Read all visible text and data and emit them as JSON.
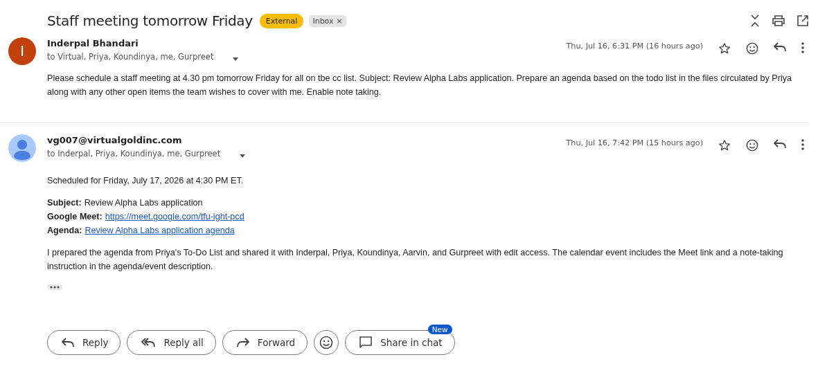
{
  "subject": "Staff meeting tomorrow Friday",
  "labels": [
    {
      "text": "External",
      "kind": "external",
      "removable": false
    },
    {
      "text": "Inbox",
      "kind": "folder",
      "removable": true,
      "remove_glyph": "×"
    }
  ],
  "messages": [
    {
      "sender": "Inderpal Bhandari",
      "avatar": {
        "kind": "letter",
        "letter": "I",
        "color": "#c2410c"
      },
      "recipients": "to Virtual, Priya, Koundinya, me, Gurpreet",
      "time": "Thu, Jul 16, 6:31 PM (16 hours ago)",
      "starred": false,
      "body": [
        {
          "kind": "text",
          "text": "Please schedule a staff meeting at 4.30 pm tomorrow Friday for all on tbe cc list. Subject: Review Alpha Labs application. Prepare an agenda based on the todo list in the files circulated by Priya along with any other open items the team wishes to cover with me. Enable note taking."
        }
      ]
    },
    {
      "sender": "vg007@virtualgoldinc.com",
      "avatar": {
        "kind": "silhouette",
        "color": "#a8c7fa"
      },
      "recipients": "to Inderpal, Priya, Koundinya, me, Gurpreet",
      "time": "Thu, Jul 16, 7:42 PM (15 hours ago)",
      "starred": false,
      "body": [
        {
          "kind": "text",
          "text": "Scheduled for Friday, July 17, 2026 at 4:30 PM ET."
        },
        {
          "kind": "fields",
          "fields": [
            {
              "label": "Subject:",
              "value": "Review Alpha Labs application",
              "link": false
            },
            {
              "label": "Google Meet:",
              "value": "https://meet.google.com/tfu-ight-pcd",
              "link": true
            },
            {
              "label": "Agenda:",
              "value": "Review Alpha Labs application agenda",
              "link": true
            }
          ]
        },
        {
          "kind": "text",
          "text": "I prepared the agenda from Priya's To-Do List and shared it with Inderpal, Priya, Koundinya, Aarvin, and Gurpreet with edit access. The calendar event includes the Meet link and a note-taking instruction in the agenda/event description."
        },
        {
          "kind": "more"
        }
      ]
    }
  ],
  "actions": [
    {
      "kind": "reply",
      "label": "Reply"
    },
    {
      "kind": "reply-all",
      "label": "Reply all"
    },
    {
      "kind": "forward",
      "label": "Forward"
    },
    {
      "kind": "emoji"
    },
    {
      "kind": "chat",
      "label": "Share in chat",
      "badge": "New"
    }
  ]
}
